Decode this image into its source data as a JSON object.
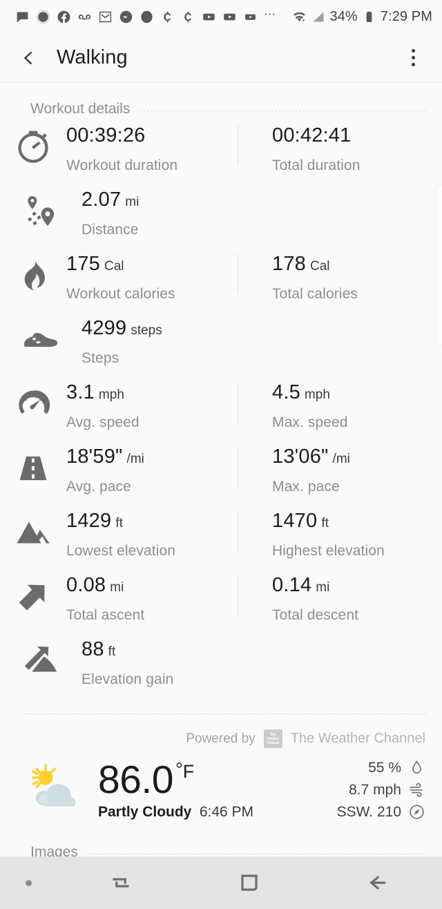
{
  "status_bar": {
    "icons": [
      "message-icon",
      "signal-messenger-icon",
      "facebook-icon",
      "voicemail-icon",
      "gmail-icon",
      "messenger-icon",
      "circle-app-icon",
      "cent-icon",
      "cent-icon-2",
      "youtube-icon",
      "youtube-icon-2",
      "youtube-icon-3"
    ],
    "overflow": "⋯",
    "wifi_icon": "wifi-icon",
    "cellular_icon": "cellular-signal-icon",
    "battery_percent": "34%",
    "battery_icon": "battery-icon",
    "time": "7:29 PM"
  },
  "app_bar": {
    "back_icon": "back-chevron-icon",
    "title": "Walking",
    "more_icon": "overflow-menu-icon"
  },
  "workout_details": {
    "section_title": "Workout details",
    "rows": [
      {
        "icon": "stopwatch-icon",
        "left": {
          "value": "00:39:26",
          "unit": "",
          "label": "Workout duration"
        },
        "right": {
          "value": "00:42:41",
          "unit": "",
          "label": "Total duration"
        }
      },
      {
        "icon": "route-pins-icon",
        "left": {
          "value": "2.07",
          "unit": "mi",
          "label": "Distance"
        },
        "right": null
      },
      {
        "icon": "flame-icon",
        "left": {
          "value": "175",
          "unit": "Cal",
          "label": "Workout calories"
        },
        "right": {
          "value": "178",
          "unit": "Cal",
          "label": "Total calories"
        }
      },
      {
        "icon": "shoe-icon",
        "left": {
          "value": "4299",
          "unit": "steps",
          "label": "Steps"
        },
        "right": null
      },
      {
        "icon": "speedometer-icon",
        "left": {
          "value": "3.1",
          "unit": "mph",
          "label": "Avg. speed"
        },
        "right": {
          "value": "4.5",
          "unit": "mph",
          "label": "Max. speed"
        }
      },
      {
        "icon": "road-icon",
        "left": {
          "value": "18'59\"",
          "unit": "/mi",
          "label": "Avg. pace"
        },
        "right": {
          "value": "13'06\"",
          "unit": "/mi",
          "label": "Max. pace"
        }
      },
      {
        "icon": "mountain-icon",
        "left": {
          "value": "1429",
          "unit": "ft",
          "label": "Lowest elevation"
        },
        "right": {
          "value": "1470",
          "unit": "ft",
          "label": "Highest elevation"
        }
      },
      {
        "icon": "arrow-up-right-icon",
        "left": {
          "value": "0.08",
          "unit": "mi",
          "label": "Total ascent"
        },
        "right": {
          "value": "0.14",
          "unit": "mi",
          "label": "Total descent"
        }
      },
      {
        "icon": "elevation-gain-icon",
        "left": {
          "value": "88",
          "unit": "ft",
          "label": "Elevation gain"
        },
        "right": null
      }
    ]
  },
  "weather": {
    "powered_by": "Powered by",
    "provider": "The Weather Channel",
    "provider_logo_lines": [
      "The",
      "Weather",
      "Channel"
    ],
    "icon": "partly-cloudy-icon",
    "temperature": "86.0",
    "degree_symbol": "°",
    "temp_unit": "F",
    "condition": "Partly Cloudy",
    "observed_time": "6:46 PM",
    "humidity": {
      "value": "55 %",
      "icon": "humidity-droplet-icon"
    },
    "wind": {
      "value": "8.7 mph",
      "icon": "wind-icon"
    },
    "direction": {
      "value": "SSW. 210",
      "icon": "compass-icon"
    }
  },
  "images_section": {
    "title": "Images"
  },
  "nav_bar": {
    "dot": "home-indicator-dot",
    "recents_icon": "recents-icon",
    "home_icon": "home-square-icon",
    "back_icon": "back-arrow-icon"
  },
  "colors": {
    "background": "#fafafa",
    "primary_text": "#1c1c1c",
    "secondary_text": "#8b8e90",
    "icon_gray": "#6b6b6b",
    "nav_bar": "#e4e4e4",
    "sun_yellow": "#ffd02e",
    "cloud_blue": "#cddde2"
  }
}
